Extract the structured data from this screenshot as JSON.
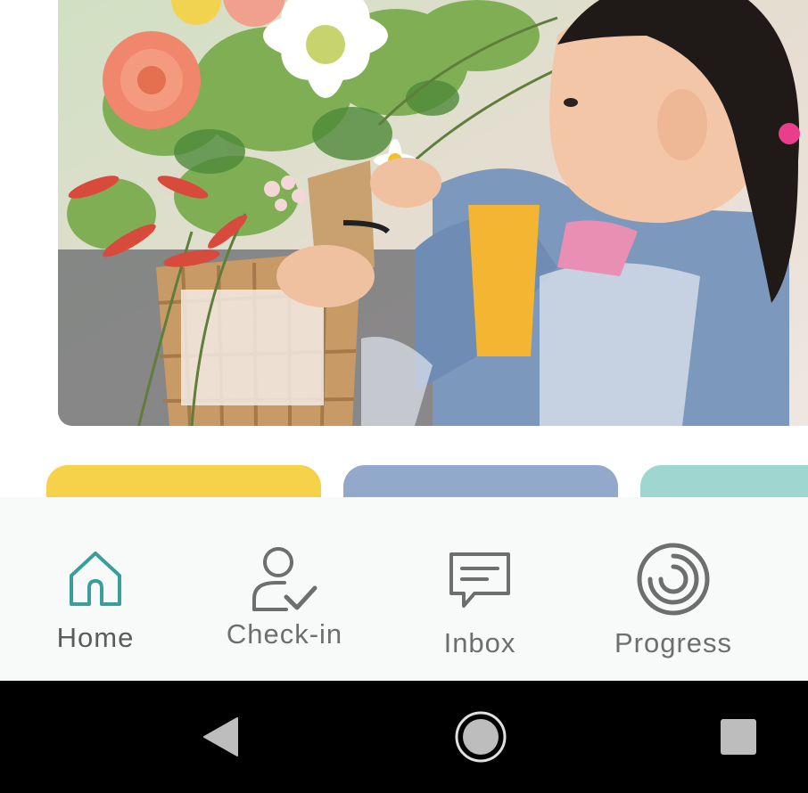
{
  "hero": {
    "alt": "photo-girl-arranging-flowers"
  },
  "cards": [
    {
      "color": "#f6d24a"
    },
    {
      "color": "#93a9cc"
    },
    {
      "color": "#9fd6d0"
    }
  ],
  "bottom_nav": {
    "items": [
      {
        "label": "Home",
        "icon": "home-icon",
        "active": true,
        "color": "#3a9e9b"
      },
      {
        "label": "Check-in",
        "icon": "user-check-icon",
        "active": false
      },
      {
        "label": "Inbox",
        "icon": "message-icon",
        "active": false
      },
      {
        "label": "Progress",
        "icon": "progress-ring-icon",
        "active": false
      }
    ]
  },
  "system_bar": {
    "buttons": [
      "back",
      "home",
      "recents"
    ]
  }
}
